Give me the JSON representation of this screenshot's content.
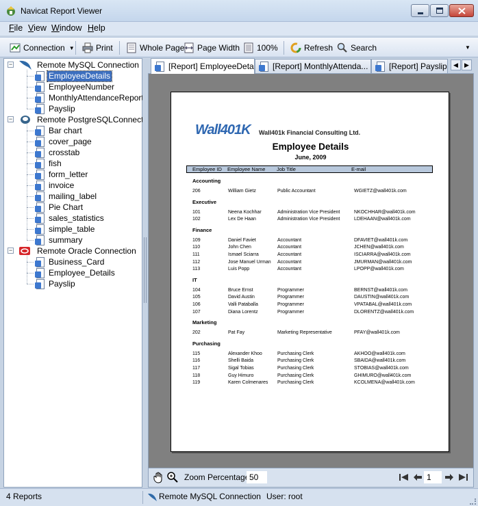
{
  "window": {
    "title": "Navicat Report Viewer"
  },
  "menu": [
    "File",
    "View",
    "Window",
    "Help"
  ],
  "toolbar": {
    "connection": "Connection",
    "print": "Print",
    "whole_page": "Whole Page",
    "page_width": "Page Width",
    "zoom_100": "100%",
    "refresh": "Refresh",
    "search": "Search"
  },
  "tree": {
    "connections": [
      {
        "name": "Remote MySQL Connection",
        "type": "mysql",
        "reports": [
          "EmployeeDetails",
          "EmployeeNumber",
          "MonthlyAttendanceReport",
          "Payslip"
        ]
      },
      {
        "name": "Remote PostgreSQLConnection",
        "type": "postgresql",
        "reports": [
          "Bar chart",
          "cover_page",
          "crosstab",
          "fish",
          "form_letter",
          "invoice",
          "mailing_label",
          "Pie Chart",
          "sales_statistics",
          "simple_table",
          "summary"
        ]
      },
      {
        "name": "Remote Oracle Connection",
        "type": "oracle",
        "reports": [
          "Business_Card",
          "Employee_Details",
          "Payslip"
        ]
      }
    ],
    "selected": "EmployeeDetails"
  },
  "tabs": [
    "[Report] EmployeeDetails",
    "[Report] MonthlyAttenda...",
    "[Report] Payslip"
  ],
  "report": {
    "logo_text": "Wall401K",
    "company": "Wall401k Financial Consulting Ltd.",
    "title": "Employee Details",
    "subtitle": "June, 2009",
    "columns": [
      "Employee ID",
      "Employee Name",
      "Job Title",
      "E-mail"
    ],
    "departments": [
      {
        "name": "Accounting",
        "rows": [
          [
            "206",
            "William Gietz",
            "Public Accountant",
            "WGIETZ@wall401k.com"
          ]
        ]
      },
      {
        "name": "Executive",
        "rows": [
          [
            "101",
            "Neena Kochhar",
            "Administration Vice President",
            "NKOCHHAR@wall401k.com"
          ],
          [
            "102",
            "Lex De Haan",
            "Administration Vice President",
            "LDEHAAN@wall401k.com"
          ]
        ]
      },
      {
        "name": "Finance",
        "rows": [
          [
            "109",
            "Daniel Faviet",
            "Accountant",
            "DFAVIET@wall401k.com"
          ],
          [
            "110",
            "John Chen",
            "Accountant",
            "JCHEN@wall401k.com"
          ],
          [
            "111",
            "Ismael Sciarra",
            "Accountant",
            "ISCIARRA@wall401k.com"
          ],
          [
            "112",
            "Jose Manuel Urman",
            "Accountant",
            "JMURMAN@wall401k.com"
          ],
          [
            "113",
            "Luis Popp",
            "Accountant",
            "LPOPP@wall401k.com"
          ]
        ]
      },
      {
        "name": "IT",
        "rows": [
          [
            "104",
            "Bruce Ernst",
            "Programmer",
            "BERNST@wall401k.com"
          ],
          [
            "105",
            "David Austin",
            "Programmer",
            "DAUSTIN@wall401k.com"
          ],
          [
            "106",
            "Valli Pataballa",
            "Programmer",
            "VPATABAL@wall401k.com"
          ],
          [
            "107",
            "Diana Lorentz",
            "Programmer",
            "DLORENTZ@wall401k.com"
          ]
        ]
      },
      {
        "name": "Marketing",
        "rows": [
          [
            "202",
            "Pat Fay",
            "Marketing Representative",
            "PFAY@wall401k.com"
          ]
        ]
      },
      {
        "name": "Purchasing",
        "rows": [
          [
            "115",
            "Alexander Khoo",
            "Purchasing Clerk",
            "AKHOO@wall401k.com"
          ],
          [
            "116",
            "Shelli Baida",
            "Purchasing Clerk",
            "SBAIDA@wall401k.com"
          ],
          [
            "117",
            "Sigal Tobias",
            "Purchasing Clerk",
            "STOBIAS@wall401k.com"
          ],
          [
            "118",
            "Guy Himuro",
            "Purchasing Clerk",
            "GHIMURO@wall401k.com"
          ],
          [
            "119",
            "Karen Colmenares",
            "Purchasing Clerk",
            "KCOLMENA@wall401k.com"
          ]
        ]
      }
    ]
  },
  "preview_bar": {
    "zoom_label": "Zoom Percentage",
    "zoom_value": "50",
    "page_value": "1"
  },
  "status": {
    "reports_count": "4 Reports",
    "connection": "Remote MySQL Connection",
    "user": "User: root"
  },
  "colors": {
    "accent": "#3d6fbf",
    "header_band": "#b8c8dc",
    "logo_blue": "#2e67b1",
    "oracle_red": "#d6262a"
  }
}
